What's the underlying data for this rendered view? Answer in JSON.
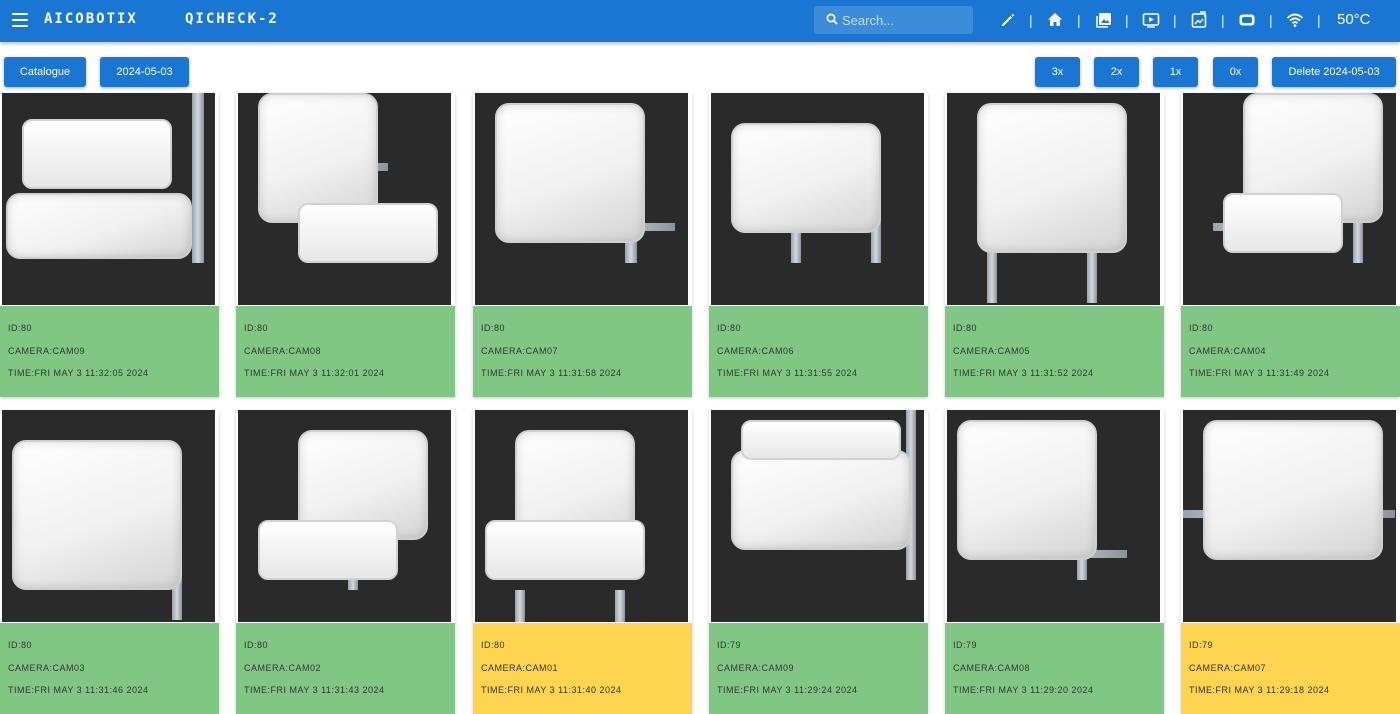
{
  "app": {
    "logo_text": "AICOBOTIX",
    "product_text": "QICHECK-2",
    "temperature": "50°C"
  },
  "search": {
    "placeholder": "Search...",
    "value": ""
  },
  "toolbar_icons": [
    "pencil-icon",
    "home-icon",
    "images-icon",
    "play-icon",
    "export-icon",
    "rectangle-icon",
    "wifi-icon"
  ],
  "actions": {
    "catalogue": "Catalogue",
    "date": "2024-05-03",
    "x3": "3x",
    "x2": "2x",
    "x1": "1x",
    "x0": "0x",
    "delete": "Delete 2024-05-03"
  },
  "colors": {
    "primary": "#1976d2",
    "ok": "#81c784",
    "warn": "#ffd54f"
  },
  "cards": [
    {
      "id": "ID:80",
      "camera": "CAMERA:CAM09",
      "time": "TIME:FRI MAY 3 11:32:05 2024",
      "status": "ok"
    },
    {
      "id": "ID:80",
      "camera": "CAMERA:CAM08",
      "time": "TIME:FRI MAY 3 11:32:01 2024",
      "status": "ok"
    },
    {
      "id": "ID:80",
      "camera": "CAMERA:CAM07",
      "time": "TIME:FRI MAY 3 11:31:58 2024",
      "status": "ok"
    },
    {
      "id": "ID:80",
      "camera": "CAMERA:CAM06",
      "time": "TIME:FRI MAY 3 11:31:55 2024",
      "status": "ok"
    },
    {
      "id": "ID:80",
      "camera": "CAMERA:CAM05",
      "time": "TIME:FRI MAY 3 11:31:52 2024",
      "status": "ok"
    },
    {
      "id": "ID:80",
      "camera": "CAMERA:CAM04",
      "time": "TIME:FRI MAY 3 11:31:49 2024",
      "status": "ok"
    },
    {
      "id": "ID:80",
      "camera": "CAMERA:CAM03",
      "time": "TIME:FRI MAY 3 11:31:46 2024",
      "status": "ok"
    },
    {
      "id": "ID:80",
      "camera": "CAMERA:CAM02",
      "time": "TIME:FRI MAY 3 11:31:43 2024",
      "status": "ok"
    },
    {
      "id": "ID:80",
      "camera": "CAMERA:CAM01",
      "time": "TIME:FRI MAY 3 11:31:40 2024",
      "status": "warn"
    },
    {
      "id": "ID:79",
      "camera": "CAMERA:CAM09",
      "time": "TIME:FRI MAY 3 11:29:24 2024",
      "status": "ok"
    },
    {
      "id": "ID:79",
      "camera": "CAMERA:CAM08",
      "time": "TIME:FRI MAY 3 11:29:20 2024",
      "status": "ok"
    },
    {
      "id": "ID:79",
      "camera": "CAMERA:CAM07",
      "time": "TIME:FRI MAY 3 11:29:18 2024",
      "status": "warn"
    }
  ]
}
